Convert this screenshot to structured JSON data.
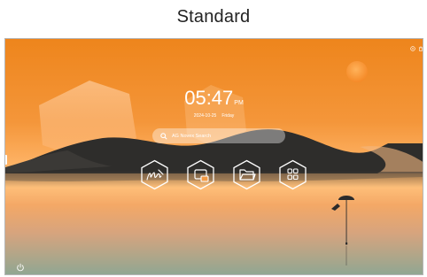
{
  "heading": "Standard",
  "clock": {
    "time": "05:47",
    "ampm": "PM",
    "date": "2024-10-25",
    "weekday": "Friday"
  },
  "search": {
    "placeholder": "AG Novex Search"
  },
  "apps": [
    {
      "name": "whiteboard",
      "icon": "pen-scribble-icon"
    },
    {
      "name": "screen-share",
      "icon": "cast-screen-icon"
    },
    {
      "name": "files",
      "icon": "folder-icon"
    },
    {
      "name": "app-drawer",
      "icon": "apps-grid-icon"
    }
  ],
  "status_icons": [
    "network-icon",
    "trash-icon"
  ],
  "bottom_left": "power-icon",
  "colors": {
    "sky_top": "#f08a20",
    "sky_mid": "#ffae55",
    "hill": "#2f2f2f",
    "water": "#9aa68a"
  }
}
